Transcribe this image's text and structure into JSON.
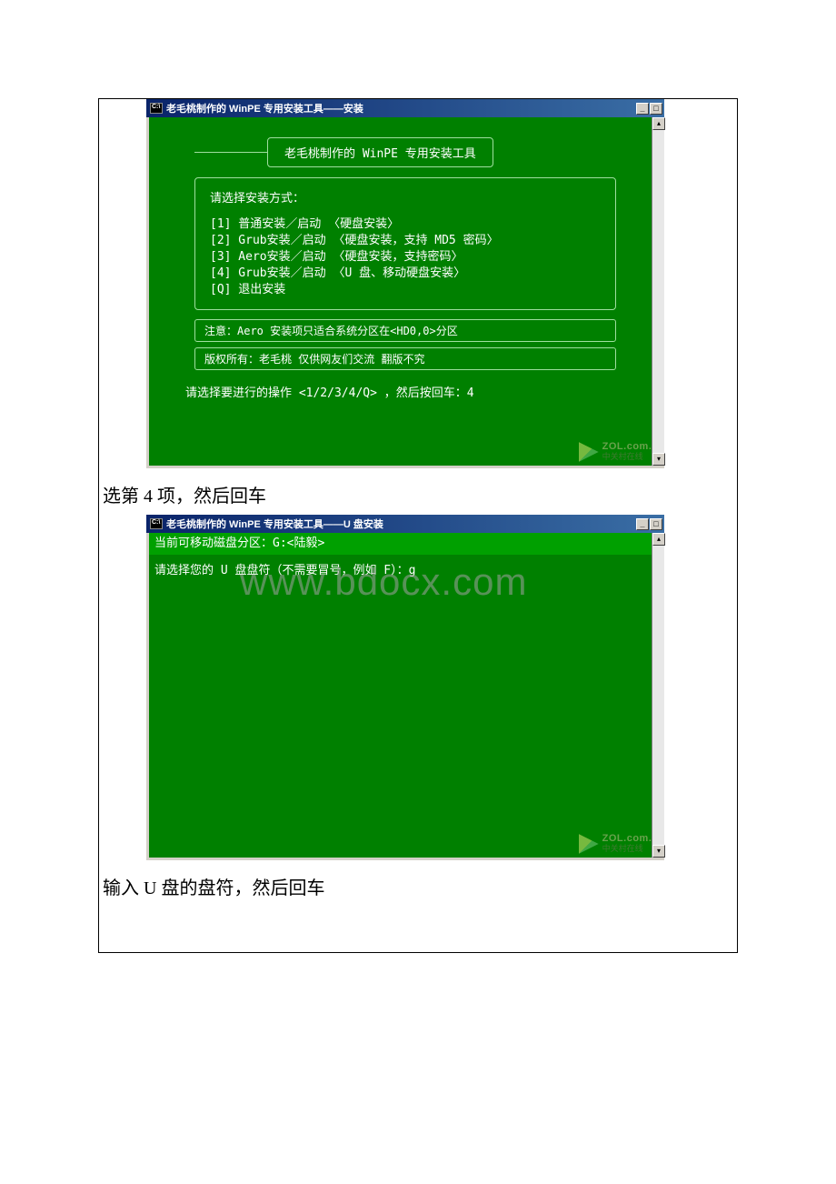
{
  "window1": {
    "title": "老毛桃制作的 WinPE 专用安装工具——安装",
    "banner": "老毛桃制作的 WinPE 专用安装工具",
    "select_label": "请选择安装方式：",
    "menu": {
      "i1": "[1] 普通安装／启动 〈硬盘安装〉",
      "i2": "[2] Grub安装／启动 〈硬盘安装，支持 MD5 密码〉",
      "i3": "[3] Aero安装／启动 〈硬盘安装，支持密码〉",
      "i4": "[4] Grub安装／启动 〈U 盘、移动硬盘安装〉",
      "iq": "[Q] 退出安装"
    },
    "note": "注意：Aero 安装项只适合系统分区在<HD0,0>分区",
    "copyright": "版权所有：老毛桃     仅供网友们交流  翻版不究",
    "prompt": "请选择要进行的操作 <1/2/3/4/Q> ，然后按回车：4"
  },
  "doc_text1": "选第 4 项，然后回车",
  "window2": {
    "title": "老毛桃制作的 WinPE 专用安装工具——U 盘安装",
    "line1": "当前可移动磁盘分区：G:<陆毅>",
    "line2": "请选择您的 U 盘盘符（不需要冒号，例如 F）：g"
  },
  "doc_text2": "输入 U 盘的盘符，然后回车",
  "watermark": {
    "l1": "ZOL.com.c",
    "l2": "中关村在线"
  },
  "big_watermark": "www.bdocx.com",
  "win_controls": {
    "min": "_",
    "max": "□",
    "close": "×"
  }
}
